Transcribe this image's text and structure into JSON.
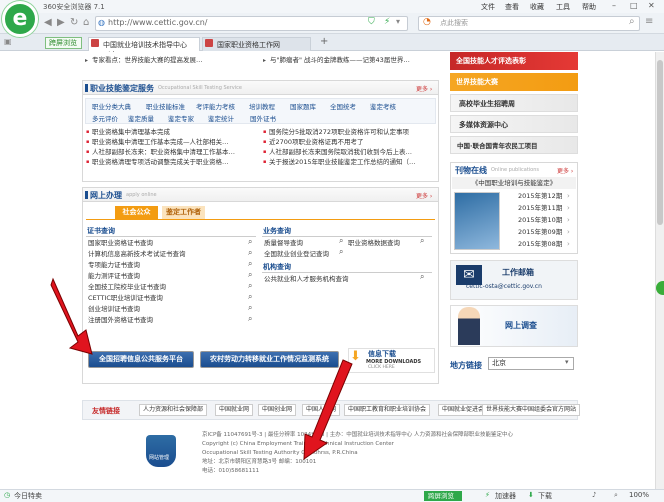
{
  "browser": {
    "title": "360安全浏览器 7.1",
    "menu": [
      "文件",
      "查看",
      "收藏",
      "工具",
      "帮助"
    ],
    "url": "http://www.cettic.gov.cn/",
    "search_placeholder": "点此搜索",
    "applink": "跨屏浏览",
    "tabs": [
      "中国就业培训技术指导中心（人...",
      "国家职业资格工作网"
    ],
    "newtab": "+"
  },
  "top_news": {
    "left": "专家看点：世界技能大赛的提高发展…",
    "right": "与\"肺瘤者\" 战斗的金牌教练——记第43届世界…"
  },
  "skill": {
    "title": "职业技能鉴定服务",
    "subtitle": "Occupational Skill Testing Service",
    "more": "更多 ›",
    "row1": [
      "职业分类大典",
      "职业技能标准",
      "考评能力考核",
      "培训教程",
      "国家题库",
      "全国统考",
      "鉴定考核"
    ],
    "row2": [
      "多元评价",
      "鉴定质量",
      "鉴定专家",
      "鉴定统计",
      "国外证书"
    ],
    "news_left": [
      "职业资格集中清理基本完成",
      "职业资格集中清理工作基本完成—人社部相关…",
      "人社部副部长冻来：职业资格集中清理工作基本…",
      "职业资格清理专项活动调整完成关于职业资格…"
    ],
    "news_right": [
      "国务院分5批取消272项职业资格许可和认定事项",
      "近2700项职业资格证再不用考了",
      "人社部副部长冻来国务院取消我们收到今后上表…",
      "关于报送2015年职业技能鉴定工作总结的通知（…"
    ]
  },
  "online": {
    "title": "网上办理",
    "subtitle": "apply online",
    "more": "更多 ›",
    "tabs": [
      "社会公众",
      "鉴定工作者"
    ],
    "cert_title": "证书查询",
    "cert_items": [
      "国家职业资格证书查询",
      "计算机信息高新技术考试证书查询",
      "专项能力证书查询",
      "能力测评证书查询",
      "全国技工院校毕业证书查询",
      "CETTIC职业培训证书查询",
      "创业培训证书查询",
      "注册国外资格证书查询"
    ],
    "biz_title": "业务查询",
    "biz_items": [
      "质量督导查询",
      "全国就业创业登记查询"
    ],
    "biz_right": "职业资格数据查询",
    "org_title": "机构查询",
    "org_items": [
      "公共就业和人才服务机构查询"
    ]
  },
  "banners": {
    "recruit": "全国招聘信息公共服务平台",
    "rural": "农村劳动力转移就业工作情况监测系统",
    "info_title": "信息下载",
    "info_sub": "MORE DOWNLOADS",
    "info_click": "CLICK HERE"
  },
  "right": {
    "b1": "全国技能人才评选表彰",
    "b2": "世界技能大赛",
    "b3": "高校毕业生招聘周",
    "b4": "多媒体资源中心",
    "b5": "中国·联合国青年农民工项目",
    "pub_title": "刊物在线",
    "pub_sub": "Online publications",
    "pub_more": "更多 ›",
    "journal_title": "《中国职业培训与技能鉴定》",
    "issues": [
      "2015年第12期",
      "2015年第11期",
      "2015年第10期",
      "2015年第09期",
      "2015年第08期"
    ],
    "mail_title": "工作邮箱",
    "mail_addr": "cettic-osta@cettic.gov.cn",
    "survey": "网上调查",
    "region_label": "地方链接",
    "region_value": "北京"
  },
  "footer": {
    "links_title": "友情链接",
    "links": [
      "人力资源和社会保障部",
      "中国就业网",
      "中国创业网",
      "中国人才网",
      "中国职工教育和职业培训协会",
      "中国就业促进会",
      "世界技能大赛中国组委会官方网站"
    ],
    "badge": "网站管理",
    "lines": [
      "京ICP备 11047691号-3 | 最佳分辨率 1024*768 | 主办：中国就业培训技术指导中心  人力资源和社会保障部职业技能鉴定中心",
      "Copyright (c) China Employment Training Technical Instruction Center",
      "Occupational Skill Testing Authority Of Mohrss, P.R.China",
      "地址：北京市朝阳区育慧路3号    邮编：100101",
      "电话：010)58681111"
    ]
  },
  "status": {
    "left": "今日特卖",
    "applink": "跨屏浏览",
    "accel": "加速器",
    "download": "下载",
    "zoom": "100%"
  },
  "colors": {
    "green": "#2ea84a",
    "orange": "#f39c12",
    "darkblue": "#1a4d8f",
    "red": "#e0141e"
  }
}
